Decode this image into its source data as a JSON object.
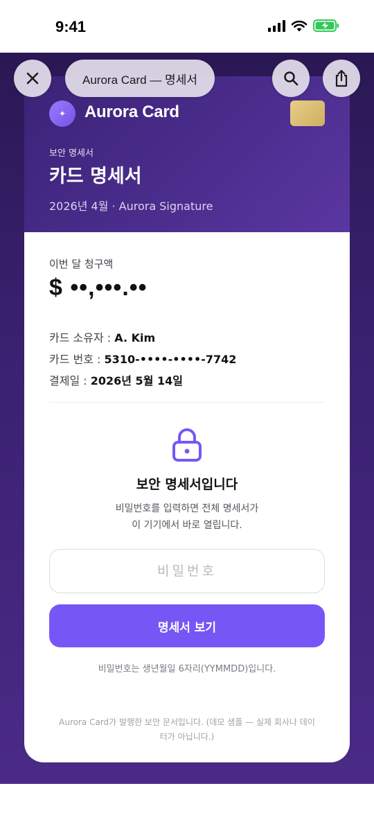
{
  "status_bar": {
    "time": "9:41"
  },
  "browser": {
    "title": "Aurora Card — 명세서"
  },
  "card": {
    "brand_name": "Aurora Card",
    "brand_glyph": "✦",
    "eyebrow": "보안 명세서",
    "title": "카드 명세서",
    "subtitle": "2026년 4월 · Aurora Signature"
  },
  "statement": {
    "amount_label": "이번 달 청구액",
    "amount_masked": "$ ••,•••.••",
    "holder_label": "카드 소유자 :",
    "holder_value": "A. Kim",
    "card_number_label": "카드 번호 :",
    "card_number_value": "5310-••••-••••-7742",
    "payment_date_label": "결제일 :",
    "payment_date_value": "2026년 5월 14일"
  },
  "lock": {
    "title": "보안 명세서입니다",
    "description_line1": "비밀번호를 입력하면 전체 명세서가",
    "description_line2": "이 기기에서 바로 열립니다.",
    "password_placeholder": "비밀번호",
    "submit_label": "명세서 보기",
    "hint": "비밀번호는 생년월일 6자리(YYMMDD)입니다."
  },
  "footer": {
    "line1": "Aurora Card가 발행한 보안 문서입니다. (데모 샘플 — 실제 회사나 데이",
    "line2": "터가 아닙니다.)"
  },
  "colors": {
    "accent": "#7657f5",
    "header_bg": "#4b2d8d",
    "chip_gold": "#d9bb70",
    "battery_green": "#34c759"
  }
}
